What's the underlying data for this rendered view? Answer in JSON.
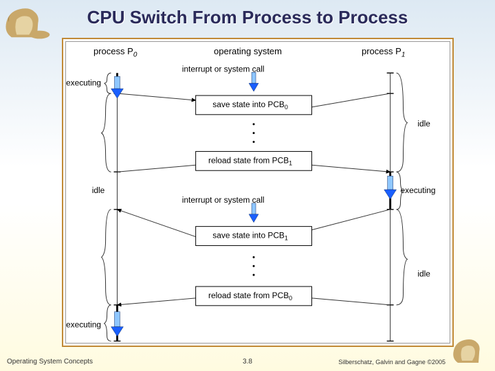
{
  "title": "CPU Switch From Process to Process",
  "header": {
    "process0": "process P",
    "process0_sub": "0",
    "os": "operating system",
    "process1": "process P",
    "process1_sub": "1"
  },
  "events": {
    "interrupt1": "interrupt or system call",
    "interrupt2": "interrupt or system call"
  },
  "boxes": {
    "save_pcb0": "save state into PCB",
    "save_pcb0_sub": "0",
    "reload_pcb1": "reload state from PCB",
    "reload_pcb1_sub": "1",
    "save_pcb1": "save state into PCB",
    "save_pcb1_sub": "1",
    "reload_pcb0": "reload state from PCB",
    "reload_pcb0_sub": "0"
  },
  "states": {
    "executing_a": "executing",
    "executing_b": "executing",
    "executing_c": "executing",
    "idle_a": "idle",
    "idle_b": "idle",
    "idle_c": "idle"
  },
  "footer": {
    "left": "Operating System Concepts",
    "center": "3.8",
    "right": "Silberschatz, Galvin and Gagne ©2005"
  }
}
